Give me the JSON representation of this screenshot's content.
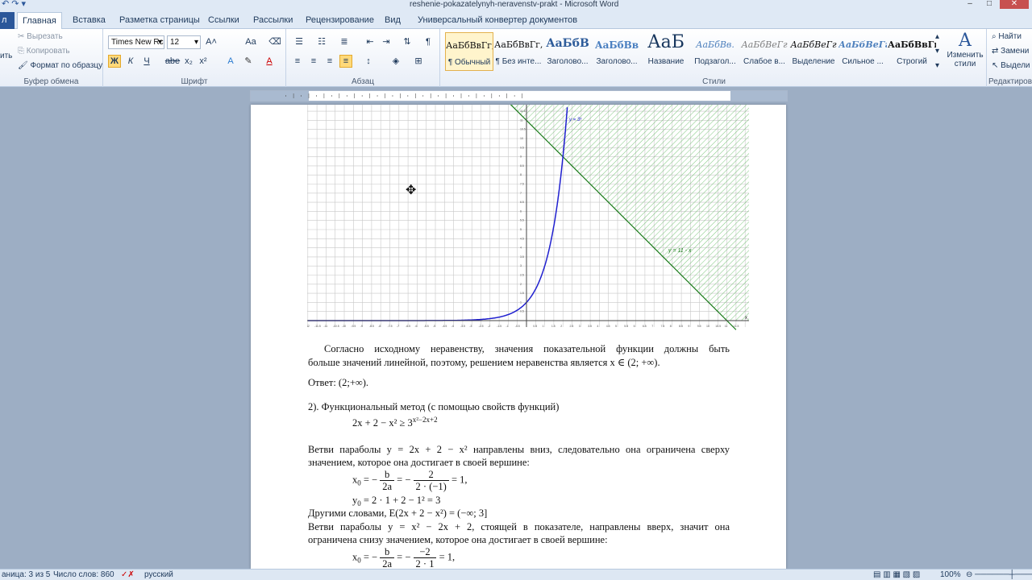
{
  "window": {
    "title": "reshenie-pokazatelynyh-neravenstv-prakt  -  Microsoft Word"
  },
  "tabs": {
    "file": "л",
    "items": [
      "Главная",
      "Вставка",
      "Разметка страницы",
      "Ссылки",
      "Рассылки",
      "Рецензирование",
      "Вид",
      "Универсальный конвертер документов"
    ]
  },
  "clipboard": {
    "cut": "Вырезать",
    "copy": "Копировать",
    "format_painter": "Формат по образцу",
    "label": "Буфер обмена"
  },
  "font": {
    "name": "Times New Rc",
    "size": "12",
    "label": "Шрифт",
    "bold": "Ж",
    "italic": "К",
    "underline": "Ч",
    "strike": "abe",
    "subscript": "x₂",
    "superscript": "x²",
    "grow": "A˄",
    "case": "Aa",
    "color": "A"
  },
  "paragraph": {
    "label": "Абзац",
    "pilcrow": "¶"
  },
  "styles": {
    "label": "Стили",
    "items": [
      {
        "sample": "АаБбВвГг,",
        "name": "¶ Обычный"
      },
      {
        "sample": "АаБбВвГг,",
        "name": "¶ Без инте..."
      },
      {
        "sample": "АаБбВ",
        "name": "Заголово..."
      },
      {
        "sample": "АаБбВв",
        "name": "Заголово..."
      },
      {
        "sample": "АаБ",
        "name": "Название"
      },
      {
        "sample": "АаБбВв.",
        "name": "Подзагол..."
      },
      {
        "sample": "АаБбВеГг",
        "name": "Слабое в..."
      },
      {
        "sample": "АаБбВеГг",
        "name": "Выделение"
      },
      {
        "sample": "АаБбВеГг",
        "name": "Сильное ..."
      },
      {
        "sample": "АаБбВвГг",
        "name": "Строгий"
      }
    ],
    "change": "Изменить стили"
  },
  "editing": {
    "label": "Редактирова",
    "find": "Найти",
    "replace": "Замени",
    "select": "Выдели"
  },
  "graph": {
    "label_exp": "y = 3ˣ",
    "label_lin": "y = 11 - x",
    "x_axis": "x"
  },
  "document": {
    "p1_line1": "Согласно исходному неравенству, значения показательной функции должны быть",
    "p1_line2": "больше значений линейной, поэтому, решением неравенства является x ∈ (2; +∞).",
    "answer": "Ответ: (2;+∞).",
    "item2": "2).    Функциональный метод (с помощью свойств функций)",
    "ineq": "2x + 2 − x² ≥ 3",
    "ineq_sup": "x²−2x+2",
    "p2_line1": "Ветви параболы y = 2x + 2 − x² направлены вниз, следовательно она ограничена сверху",
    "p2_line2": "значением, которое она достигает в своей вершине:",
    "x0_lhs": "x",
    "x0_b": "b",
    "x0_2a": "2a",
    "x0_2": "2",
    "x0_den": "2 · (−1)",
    "x0_res": "= 1,",
    "y0": "= 2 · 1 + 2 − 1² = 3",
    "other": "Другими словами, E(2x + 2 − x²) = (−∞; 3]",
    "p3_line1": "Ветви параболы y = x² − 2x + 2, стоящей в показателе, направлены вверх, значит она",
    "p3_line2": "ограничена снизу значением, которое она достигает в своей вершине:",
    "x0b_num": "−2",
    "x0b_den": "2 · 1",
    "x0b_res": "= 1,"
  },
  "statusbar": {
    "page": "аница: 3 из 5",
    "words": "Число слов: 860",
    "lang": "русский",
    "zoom": "100%"
  },
  "colors": {
    "exp_curve": "#1f1fcf",
    "line": "#1a7a1a",
    "hatch": "#5cb85c",
    "grid": "#c8c8c8"
  }
}
